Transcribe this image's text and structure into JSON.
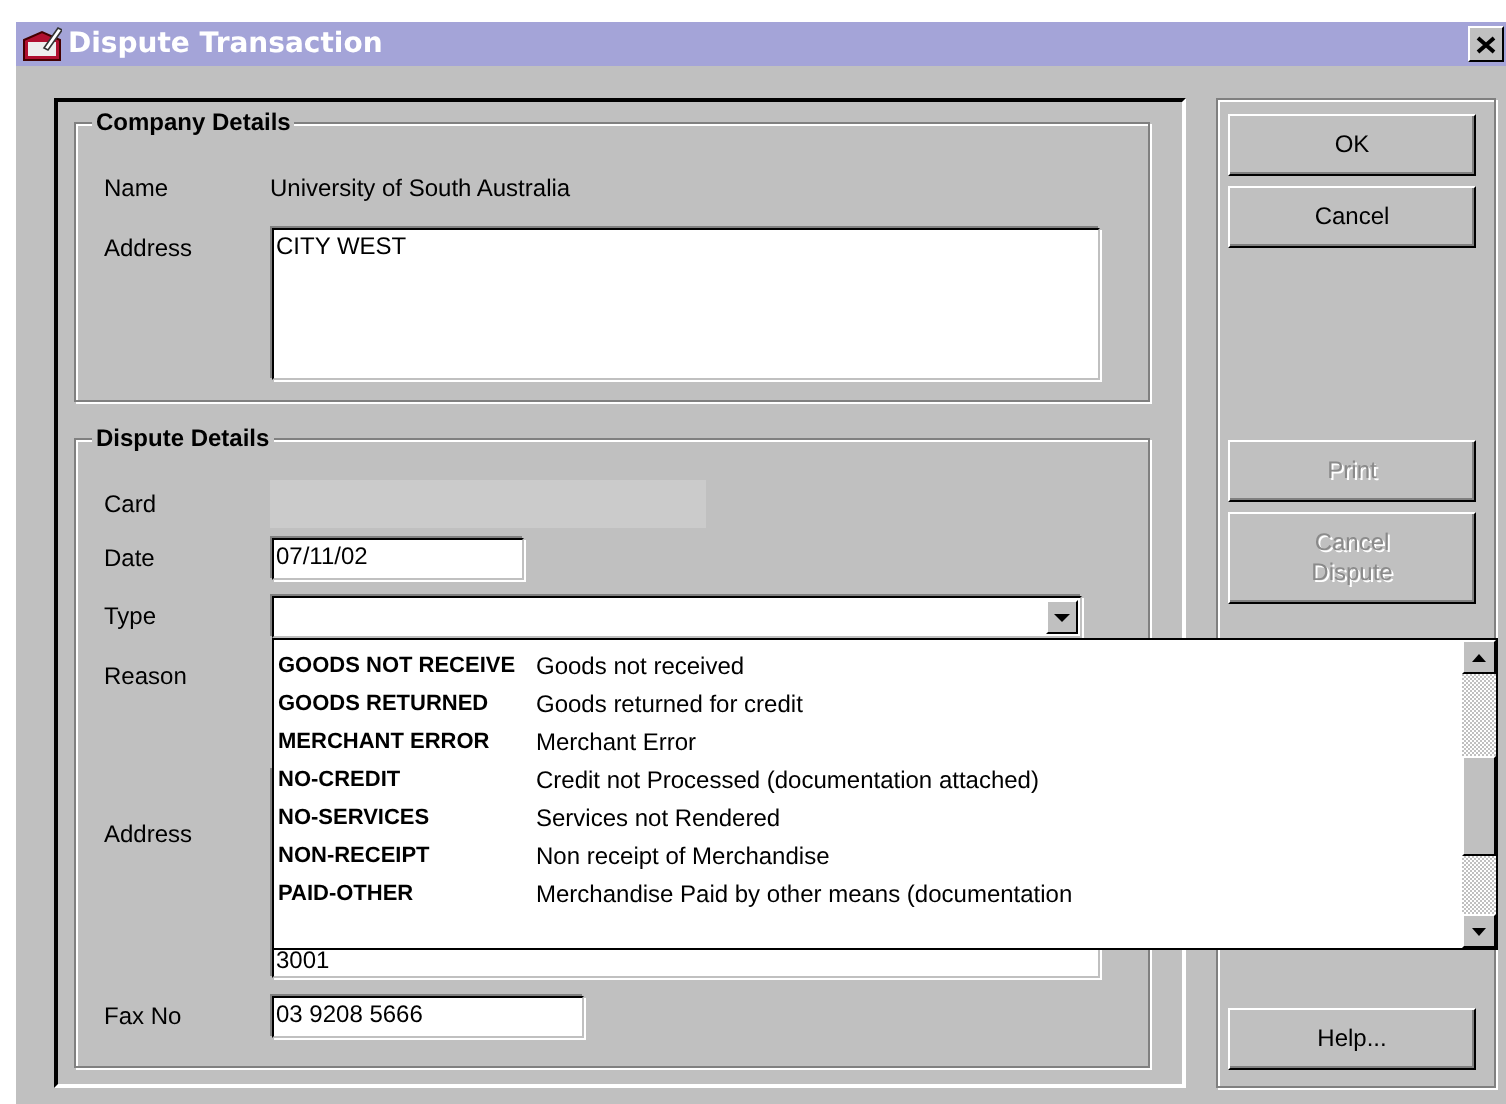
{
  "window": {
    "title": "Dispute Transaction"
  },
  "company_details": {
    "title": "Company Details",
    "name_label": "Name",
    "name": "University of South Australia",
    "address_label": "Address",
    "address": "CITY WEST"
  },
  "dispute_details": {
    "title": "Dispute Details",
    "card_label": "Card",
    "date_label": "Date",
    "date": "07/11/02",
    "type_label": "Type",
    "reason_label": "Reason",
    "address_label": "Address",
    "address": "3001",
    "fax_label": "Fax No",
    "fax": "03 9208 5666",
    "type_list": {
      "expanded": true,
      "options": [
        {
          "code": "GOODS NOT RECEIVE",
          "description": "Goods not received",
          "selected": false
        },
        {
          "code": "GOODS RETURNED",
          "description": "Goods returned for credit",
          "selected": false
        },
        {
          "code": "MERCHANT ERROR",
          "description": "Merchant Error",
          "selected": false
        },
        {
          "code": "NO-CREDIT",
          "description": "Credit not Processed (documentation attached)",
          "selected": false
        },
        {
          "code": "NO-SERVICES",
          "description": "Services not Rendered",
          "selected": false
        },
        {
          "code": "NON-RECEIPT",
          "description": "Non receipt of Merchandise",
          "selected": false
        },
        {
          "code": "PAID-OTHER",
          "description": "Merchandise Paid by other means (documentation",
          "selected": false
        }
      ]
    }
  },
  "button_groups": [
    [
      {
        "label": "OK",
        "disabled": false
      },
      {
        "label": "Cancel",
        "disabled": false
      }
    ],
    [
      {
        "label": "Print",
        "disabled": true
      },
      {
        "label": "Cancel Dispute",
        "disabled": true
      }
    ],
    [
      {
        "label": "Help...",
        "disabled": false
      }
    ]
  ]
}
